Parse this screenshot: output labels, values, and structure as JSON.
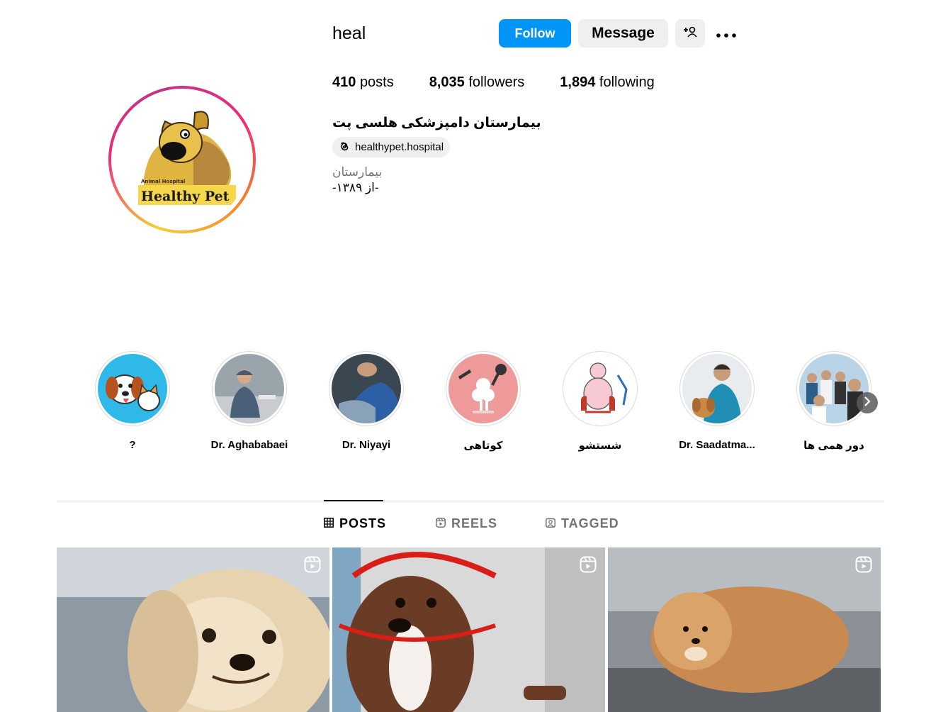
{
  "profile": {
    "username": "heal",
    "follow_label": "Follow",
    "message_label": "Message",
    "full_name": "بیمارستان دامپزشکی هلسی پت",
    "threads_handle": "healthypet.hospital",
    "category": "بیمارستان",
    "bio": "-از ۱۳۸۹-",
    "logo_text": "Healthy Pet",
    "logo_subtext": "Animal Hospital"
  },
  "stats": {
    "posts_count": "410",
    "posts_label": "posts",
    "followers_count": "8,035",
    "followers_label": "followers",
    "following_count": "1,894",
    "following_label": "following"
  },
  "highlights": [
    {
      "label": "?"
    },
    {
      "label": "Dr. Aghababaei"
    },
    {
      "label": "Dr. Niyayi"
    },
    {
      "label": "کوتاهی"
    },
    {
      "label": "شستشو"
    },
    {
      "label": "Dr. Saadatma..."
    },
    {
      "label": "دور همی ها"
    }
  ],
  "tabs": {
    "posts": "POSTS",
    "reels": "REELS",
    "tagged": "TAGGED"
  },
  "colors": {
    "follow_button": "#0095f6",
    "secondary_button": "#efefef",
    "muted_text": "#737373"
  },
  "icons": {
    "suggest": "person-add-icon",
    "more": "more-horizontal-icon",
    "threads": "threads-icon",
    "posts_tab": "grid-icon",
    "reels_tab": "reels-icon",
    "tagged_tab": "tagged-icon",
    "reel_badge": "reel-badge-icon"
  }
}
